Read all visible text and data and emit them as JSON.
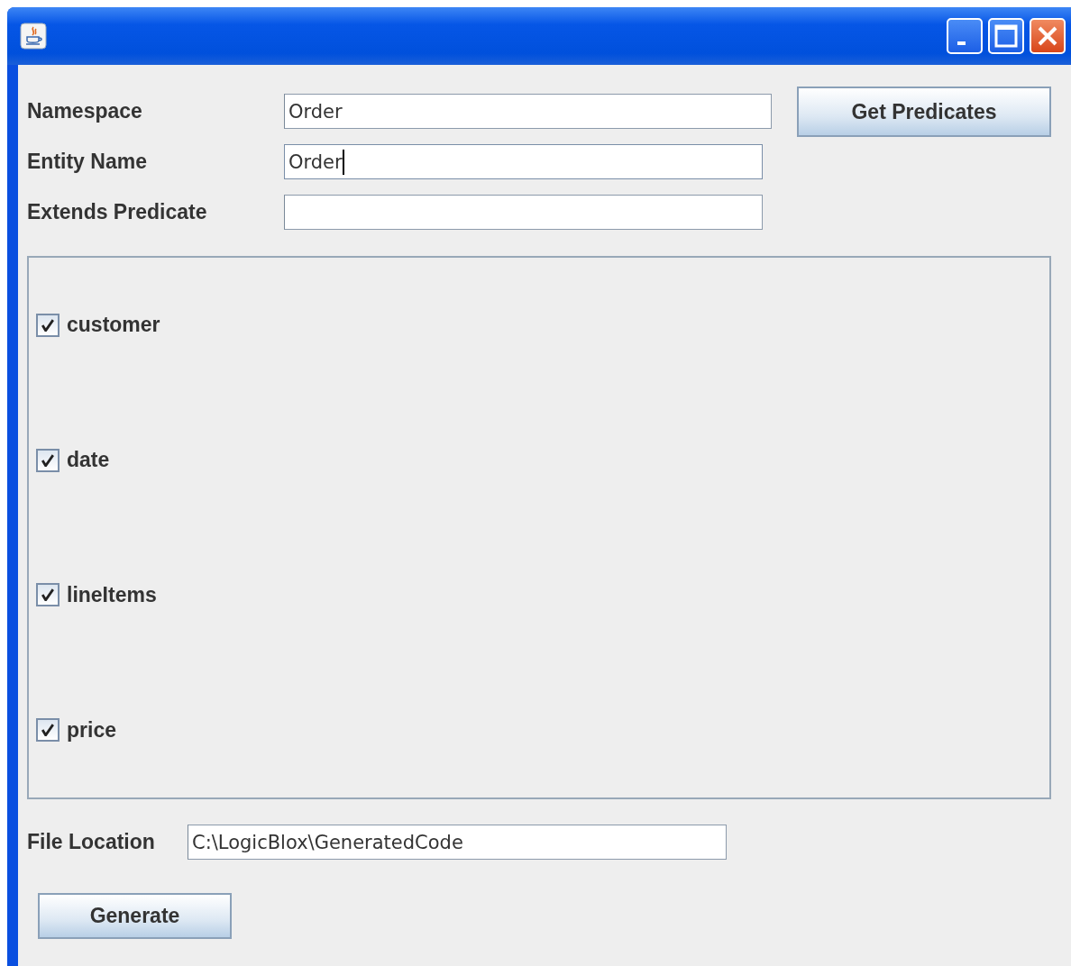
{
  "form": {
    "fields": [
      {
        "label": "Namespace",
        "value": "Order",
        "focused": false
      },
      {
        "label": "Entity Name",
        "value": "Order",
        "focused": true
      },
      {
        "label": "Extends Predicate",
        "focused": false
      }
    ],
    "get_button": "Get Predicates"
  },
  "predicates": [
    {
      "label": "customer",
      "checked": true
    },
    {
      "label": "date",
      "checked": true
    },
    {
      "label": "lineItems",
      "checked": true
    },
    {
      "label": "price",
      "checked": true
    }
  ],
  "file_location": {
    "label": "File Location",
    "value": "C:\\LogicBlox\\GeneratedCode"
  },
  "buttons": [
    "Generate"
  ]
}
